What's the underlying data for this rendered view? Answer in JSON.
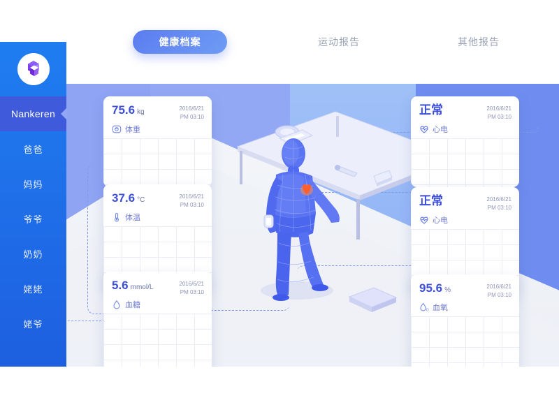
{
  "brand": {
    "logo_icon": "isometric-cube-logo"
  },
  "sidebar": {
    "active_user": "Nankeren",
    "items": [
      {
        "label": "爸爸"
      },
      {
        "label": "妈妈"
      },
      {
        "label": "爷爷"
      },
      {
        "label": "奶奶"
      },
      {
        "label": "姥姥"
      },
      {
        "label": "姥爷"
      }
    ]
  },
  "tabs": [
    {
      "label": "健康档案",
      "active": true
    },
    {
      "label": "运动报告",
      "active": false
    },
    {
      "label": "其他报告",
      "active": false
    }
  ],
  "cards": {
    "left": [
      {
        "value": "75.6",
        "unit": "kg",
        "label": "体重",
        "icon": "weight-scale-icon",
        "date": "2016/6/21",
        "time": "PM 03:10"
      },
      {
        "value": "37.6",
        "unit": "°C",
        "label": "体温",
        "icon": "thermometer-icon",
        "date": "2016/6/21",
        "time": "PM 03:10"
      },
      {
        "value": "5.6",
        "unit": "mmol/L",
        "label": "血糖",
        "icon": "blood-drop-icon",
        "date": "2016/6/21",
        "time": "PM 03:10"
      }
    ],
    "right": [
      {
        "value": "正常",
        "unit": "",
        "label": "心电",
        "icon": "heart-pulse-icon",
        "date": "2016/6/21",
        "time": "PM 03:10"
      },
      {
        "value": "正常",
        "unit": "",
        "label": "心电",
        "icon": "heart-pulse-icon",
        "date": "2016/6/21",
        "time": "PM 03:10"
      },
      {
        "value": "95.6",
        "unit": "%",
        "label": "血氧",
        "icon": "oxygen-drop-icon",
        "date": "2016/6/21",
        "time": "PM 03:10"
      }
    ]
  },
  "illustration": {
    "figure": "isometric-human-body",
    "table": "isometric-table",
    "devices": [
      "blood-pressure-monitor",
      "thermometer-device",
      "pulse-oximeter"
    ],
    "floor_device": "weight-scale-device",
    "heart_marker": "heart-hotspot"
  },
  "colors": {
    "brand_blue": "#1f7df0",
    "accent_indigo": "#3d4fd6",
    "tab_active": "#5b7cf0",
    "bg_periwinkle": "#93a8f4",
    "bg_deep": "#6f8df0",
    "floor": "#eef1f7",
    "heart_marker": "#ff6b35"
  }
}
